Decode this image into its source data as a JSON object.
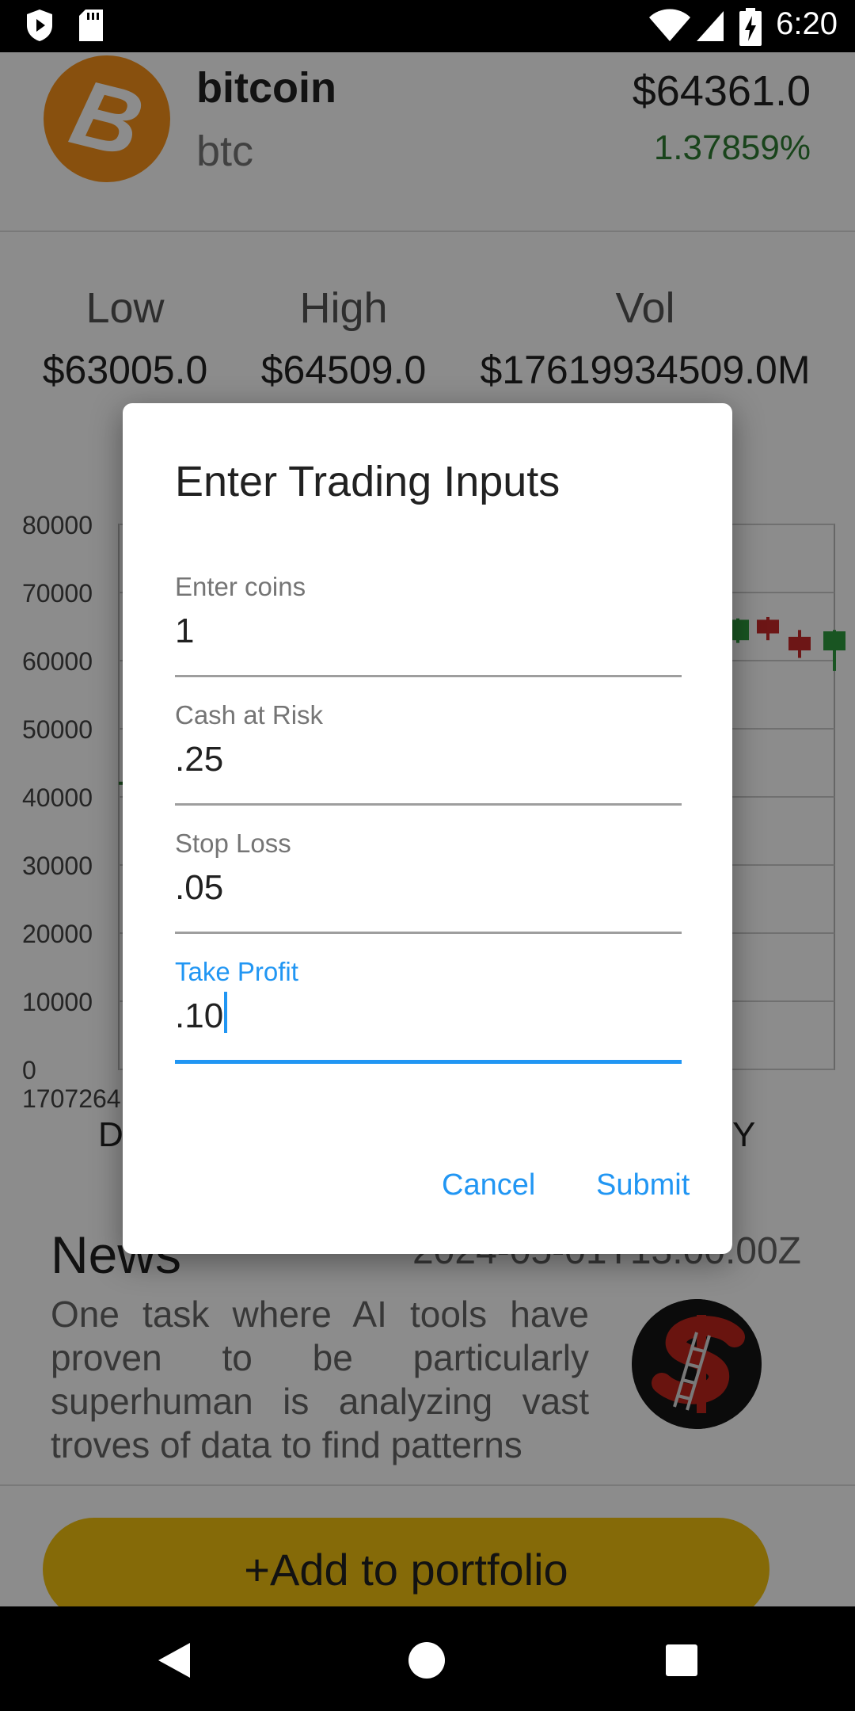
{
  "status_bar": {
    "time": "6:20"
  },
  "coin": {
    "name": "bitcoin",
    "symbol": "btc",
    "price": "$64361.0",
    "change": "1.37859%",
    "logo_glyph": "B",
    "change_color": "#2e7d32"
  },
  "stats": {
    "low_label": "Low",
    "low_value": "$63005.0",
    "high_label": "High",
    "high_value": "$64509.0",
    "vol_label": "Vol",
    "vol_value": "$17619934509.0M"
  },
  "chart_data": {
    "type": "candlestick",
    "y_ticks": [
      "80000",
      "70000",
      "60000",
      "50000",
      "40000",
      "30000",
      "20000",
      "10000",
      "0"
    ],
    "x_tick_label": "1707264",
    "ylim": [
      0,
      80000
    ],
    "candles": [
      {
        "open": 63000,
        "close": 66000,
        "high": 66200,
        "low": 62600,
        "color": "green"
      },
      {
        "open": 66000,
        "close": 64000,
        "high": 66400,
        "low": 63000,
        "color": "red"
      },
      {
        "open": 63500,
        "close": 61500,
        "high": 64500,
        "low": 60400,
        "color": "red"
      },
      {
        "open": 61500,
        "close": 64300,
        "high": 64500,
        "low": 58500,
        "color": "green"
      }
    ],
    "grid": true
  },
  "tabs": {
    "left_partial": "D",
    "right_partial": "Y"
  },
  "news": {
    "title": "News",
    "date": "2024-05-01T13:00:00Z",
    "body": "One task where AI tools have proven to be particularly superhuman is analyzing vast troves of data to find patterns"
  },
  "add_button": {
    "label": "+Add to portfolio",
    "color": "#f2c10f"
  },
  "dialog": {
    "title": "Enter Trading Inputs",
    "fields": [
      {
        "label": "Enter coins",
        "value": "1"
      },
      {
        "label": "Cash at Risk",
        "value": ".25"
      },
      {
        "label": "Stop Loss",
        "value": ".05"
      },
      {
        "label": "Take Profit",
        "value": ".10"
      }
    ],
    "cancel_label": "Cancel",
    "submit_label": "Submit",
    "accent_color": "#2196f3"
  }
}
